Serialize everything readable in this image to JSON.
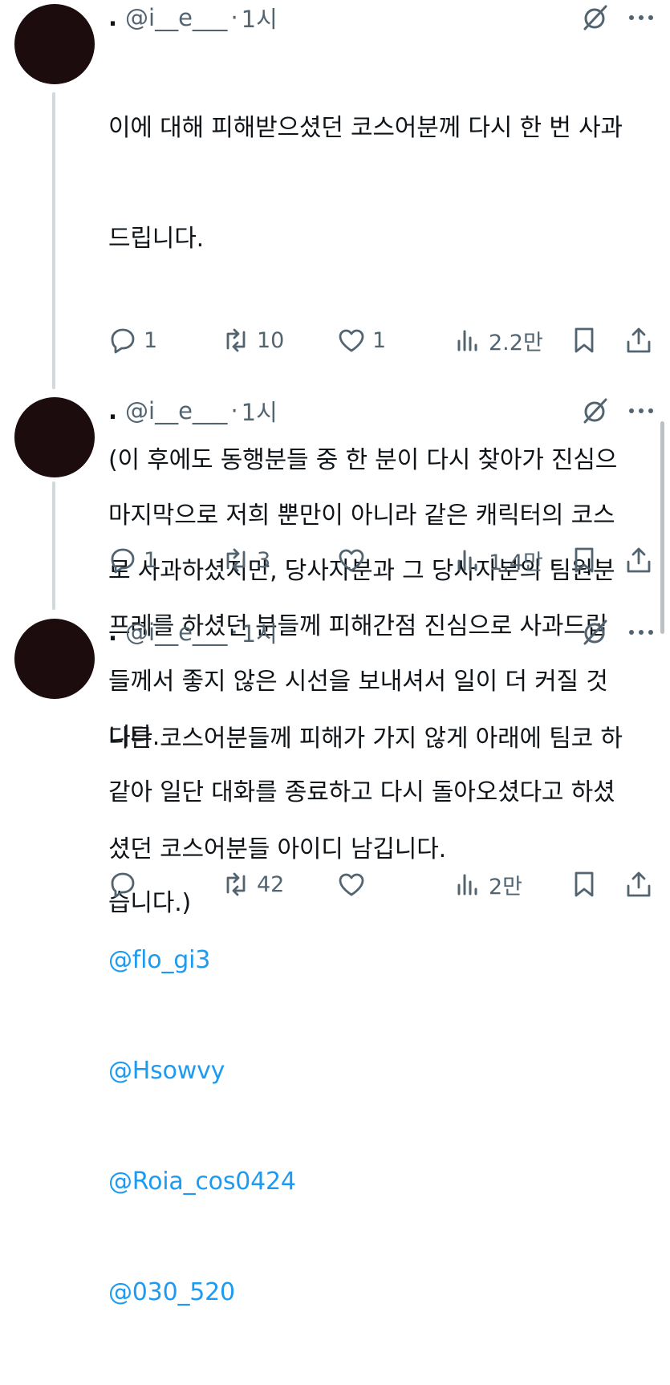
{
  "tweets": [
    {
      "handle": "@i__e___",
      "time": "1시",
      "body_lines": [
        "이에 대해 피해받으셨던 코스어분께 다시 한 번 사과",
        "드립니다.",
        "",
        "(이 후에도 동행분들 중 한 분이 다시 찾아가 진심으",
        "로 사과하셨지만, 당사자분과 그 당사자분의 팀원분",
        "들께서 좋지 않은 시선을 보내셔서 일이 더 커질 것",
        "같아 일단 대화를 종료하고 다시 돌아오셨다고 하셨",
        "습니다.)"
      ],
      "mentions": [],
      "replies": "1",
      "retweets": "10",
      "likes": "1",
      "views": "2.2만"
    },
    {
      "handle": "@i__e___",
      "time": "1시",
      "body_lines": [
        "마지막으로 저희 뿐만이 아니라 같은 캐릭터의 코스",
        "프레를 하셨던 분들께 피해간점 진심으로 사과드립",
        "니다."
      ],
      "mentions": [],
      "replies": "1",
      "retweets": "3",
      "likes": "",
      "views": "1.4만"
    },
    {
      "handle": "@i__e___",
      "time": "1시",
      "body_lines": [
        "다른 코스어분들께 피해가 가지 않게 아래에 팀코 하",
        "셨던 코스어분들 아이디 남깁니다."
      ],
      "mentions": [
        "@flo_gi3",
        "@Hsowvy",
        "@Roia_cos0424",
        "@030_520"
      ],
      "replies": "",
      "retweets": "42",
      "likes": "",
      "views": "2만"
    }
  ],
  "header_prefix": ".",
  "time_separator": "·",
  "icons": {
    "reply": "reply-icon",
    "retweet": "retweet-icon",
    "like": "like-icon",
    "views": "views-icon",
    "bookmark": "bookmark-icon",
    "share": "share-icon",
    "grok": "grok-icon",
    "more": "more-icon"
  },
  "colors": {
    "text": "#0f1419",
    "secondary": "#536471",
    "link": "#1d9bf0",
    "avatar": "#1c0c0d",
    "thread_line": "#cfd9de"
  }
}
